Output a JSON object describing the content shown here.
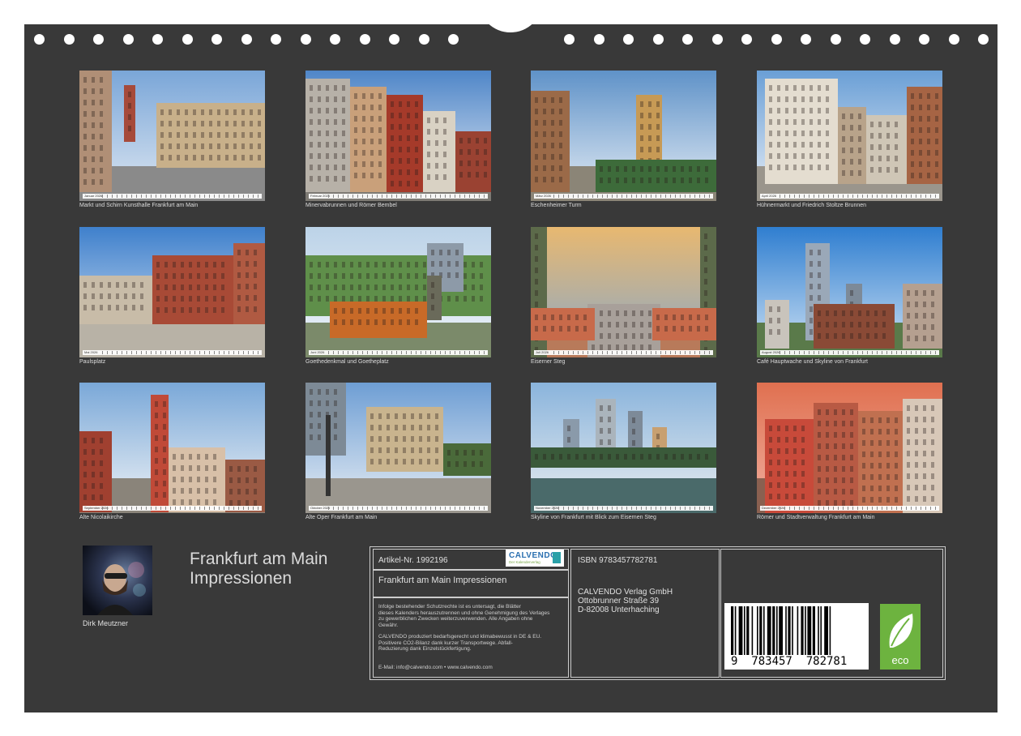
{
  "photos": [
    {
      "month": "Januar 2026",
      "caption": "Markt und Schirn Kunsthalle Frankfurt am Main"
    },
    {
      "month": "Februar 2026",
      "caption": "Minervabrunnen und Römer Bembel"
    },
    {
      "month": "März 2026",
      "caption": "Eschenheimer Turm"
    },
    {
      "month": "April 2026",
      "caption": "Hühnermarkt und Friedrich Stoltze Brunnen"
    },
    {
      "month": "Mai 2026",
      "caption": "Paulsplatz"
    },
    {
      "month": "Juni 2026",
      "caption": "Goethedenkmal und Goetheplatz"
    },
    {
      "month": "Juli 2026",
      "caption": "Eiserner Steg"
    },
    {
      "month": "August 2026",
      "caption": "Café Hauptwache und Skyline von Frankfurt"
    },
    {
      "month": "September 2026",
      "caption": "Alte Nicolaikirche"
    },
    {
      "month": "Oktober 2026",
      "caption": "Alte Oper Frankfurt am Main"
    },
    {
      "month": "November 2026",
      "caption": "Skyline von Frankfurt mit Blick zum Eisernen Steg"
    },
    {
      "month": "Dezember 2026",
      "caption": "Römer und Stadtverwaltung Frankfurt am Main"
    }
  ],
  "author": {
    "name": "Dirk Meutzner"
  },
  "title": {
    "line1": "Frankfurt am Main",
    "line2": "Impressionen"
  },
  "info": {
    "article": "Artikel-Nr. 1992196",
    "logo_text": "CALVENDO",
    "logo_sub": "Der Kalenderverlag",
    "product_title": "Frankfurt am Main Impressionen",
    "legal": [
      "Infolge bestehender Schutzrechte ist es untersagt, die Blätter",
      "dieses Kalenders herauszutrennen und ohne Genehmigung des Verlages",
      "zu gewerblichen Zwecken weiterzuverwenden. Alle Angaben ohne",
      "Gewähr."
    ],
    "eco_text": [
      "CALVENDO produziert bedarfsgerecht und klimabewusst in DE & EU.",
      "Positivere CO2-Bilanz dank kurzer Transportwege. Abfall-",
      "Reduzierung dank Einzelstückfertigung."
    ],
    "contact": "E-Mail: info@calvendo.com • www.calvendo.com",
    "isbn": "ISBN 9783457782781",
    "publisher": [
      "CALVENDO Verlag GmbH",
      "Ottobrunner Straße 39",
      "D-82008 Unterhaching"
    ],
    "barcode_digits": "9  783457  782781",
    "eco_label": "eco"
  }
}
